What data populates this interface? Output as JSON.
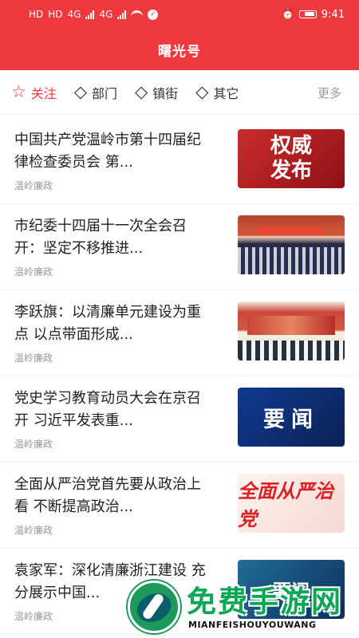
{
  "status": {
    "left_labels": [
      "HD",
      "HD",
      "4G",
      "4G"
    ],
    "time": "9:41"
  },
  "header": {
    "title": "曙光号"
  },
  "tabs": [
    {
      "label": "关注",
      "icon": "star-outline-icon",
      "active": true
    },
    {
      "label": "部门",
      "icon": "layers-icon",
      "active": false
    },
    {
      "label": "镇街",
      "icon": "layers-icon",
      "active": false
    },
    {
      "label": "其它",
      "icon": "layers-icon",
      "active": false
    }
  ],
  "more_label": "更多",
  "articles": [
    {
      "title": "中国共产党温岭市第十四届纪律检查委员会 第...",
      "source": "温岭廉政",
      "thumb_text": [
        "权威",
        "发布"
      ]
    },
    {
      "title": "市纪委十四届十一次全会召开：坚定不移推进...",
      "source": "温岭廉政"
    },
    {
      "title": "李跃旗：以清廉单元建设为重点 以点带面形成...",
      "source": "温岭廉政"
    },
    {
      "title": "党史学习教育动员大会在京召开 习近平发表重...",
      "source": "温岭廉政",
      "thumb_text": "要闻"
    },
    {
      "title": "全面从严治党首先要从政治上看 不断提高政治...",
      "source": "温岭廉政",
      "thumb_text": "全面从严治党"
    },
    {
      "title": "袁家军：深化清廉浙江建设 充分展示中国...",
      "source": "温岭廉政",
      "thumb_text": "要闻"
    }
  ],
  "watermark": {
    "title": "免费手游网",
    "subtitle": "MIANFEISHOUYOUWANG"
  },
  "colors": {
    "brand": "#f0393f",
    "background": "#ffffff",
    "muted_text": "#999999"
  }
}
